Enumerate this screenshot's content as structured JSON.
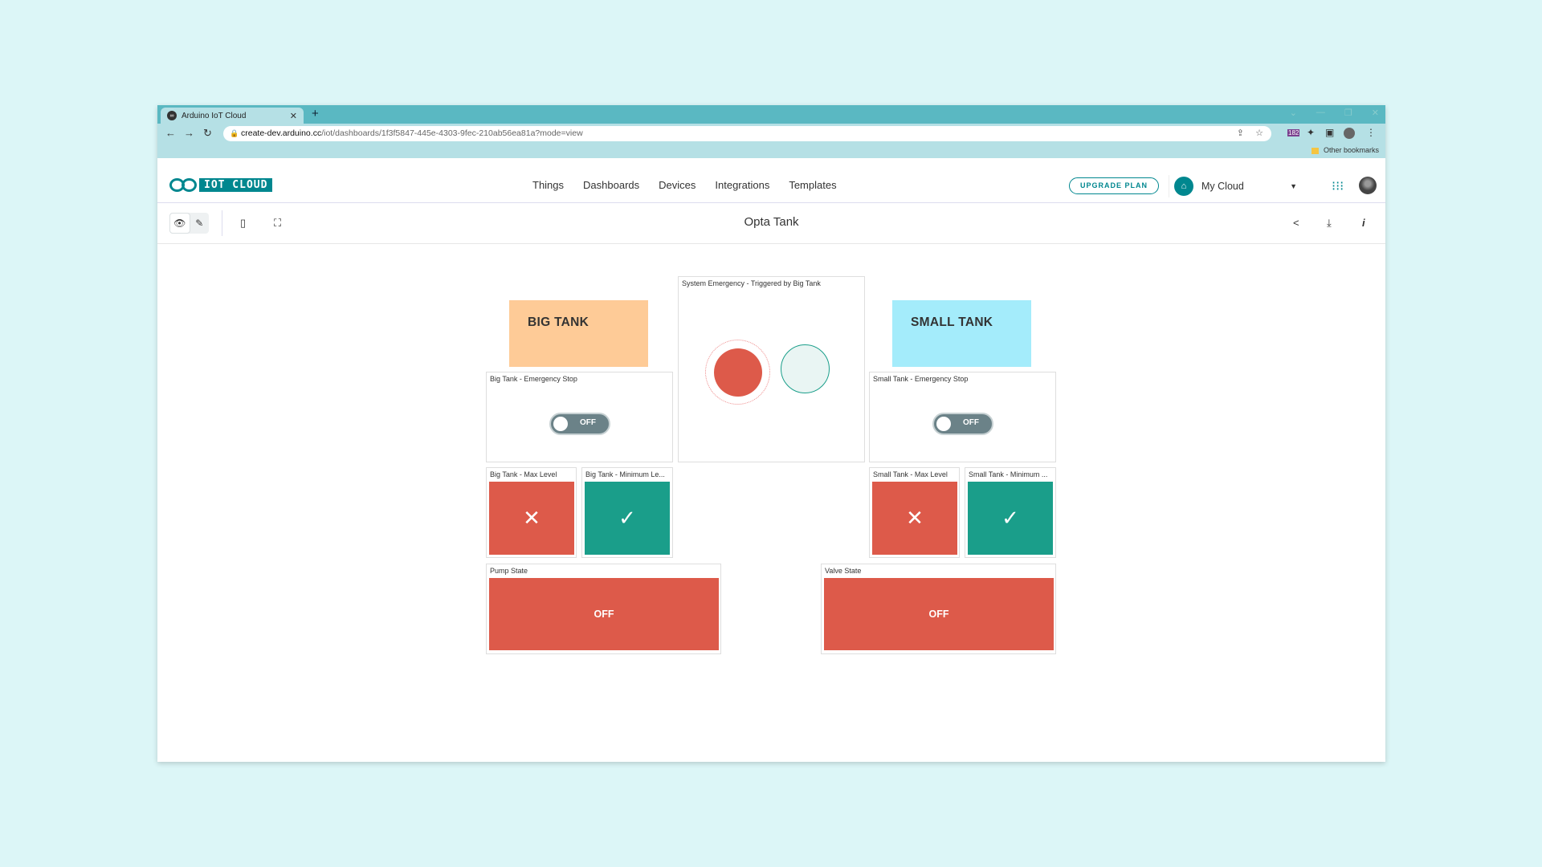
{
  "browser": {
    "tab_title": "Arduino IoT Cloud",
    "url_host": "create-dev.arduino.cc",
    "url_path": "/iot/dashboards/1f3f5847-445e-4303-9fec-210ab56ea81a?mode=view",
    "bookmarks_other": "Other bookmarks",
    "ext_badge": "182"
  },
  "app": {
    "brand": "IOT CLOUD",
    "nav": [
      "Things",
      "Dashboards",
      "Devices",
      "Integrations",
      "Templates"
    ],
    "upgrade_label": "UPGRADE PLAN",
    "space_name": "My Cloud",
    "accent": "#00878f"
  },
  "dashboard": {
    "title": "Opta Tank",
    "widgets": {
      "big_tank_sticky": "BIG TANK",
      "small_tank_sticky": "SMALL TANK",
      "system_emergency": {
        "label": "System Emergency - Triggered by Big Tank",
        "active": true
      },
      "big_estop": {
        "label": "Big Tank - Emergency Stop",
        "state": "OFF"
      },
      "small_estop": {
        "label": "Small Tank - Emergency Stop",
        "state": "OFF"
      },
      "big_max": {
        "label": "Big Tank - Max Level",
        "value": false
      },
      "big_min": {
        "label": "Big Tank - Minimum Le...",
        "value": true
      },
      "small_max": {
        "label": "Small Tank - Max Level",
        "value": false
      },
      "small_min": {
        "label": "Small Tank - Minimum ...",
        "value": true
      },
      "pump": {
        "label": "Pump State",
        "state": "OFF"
      },
      "valve": {
        "label": "Valve State",
        "state": "OFF"
      }
    },
    "colors": {
      "alert_red": "#dd5a4a",
      "ok_green": "#1a9e8a",
      "big_tank_sticky": "#fecb97",
      "small_tank_sticky": "#a4ecfb"
    }
  }
}
